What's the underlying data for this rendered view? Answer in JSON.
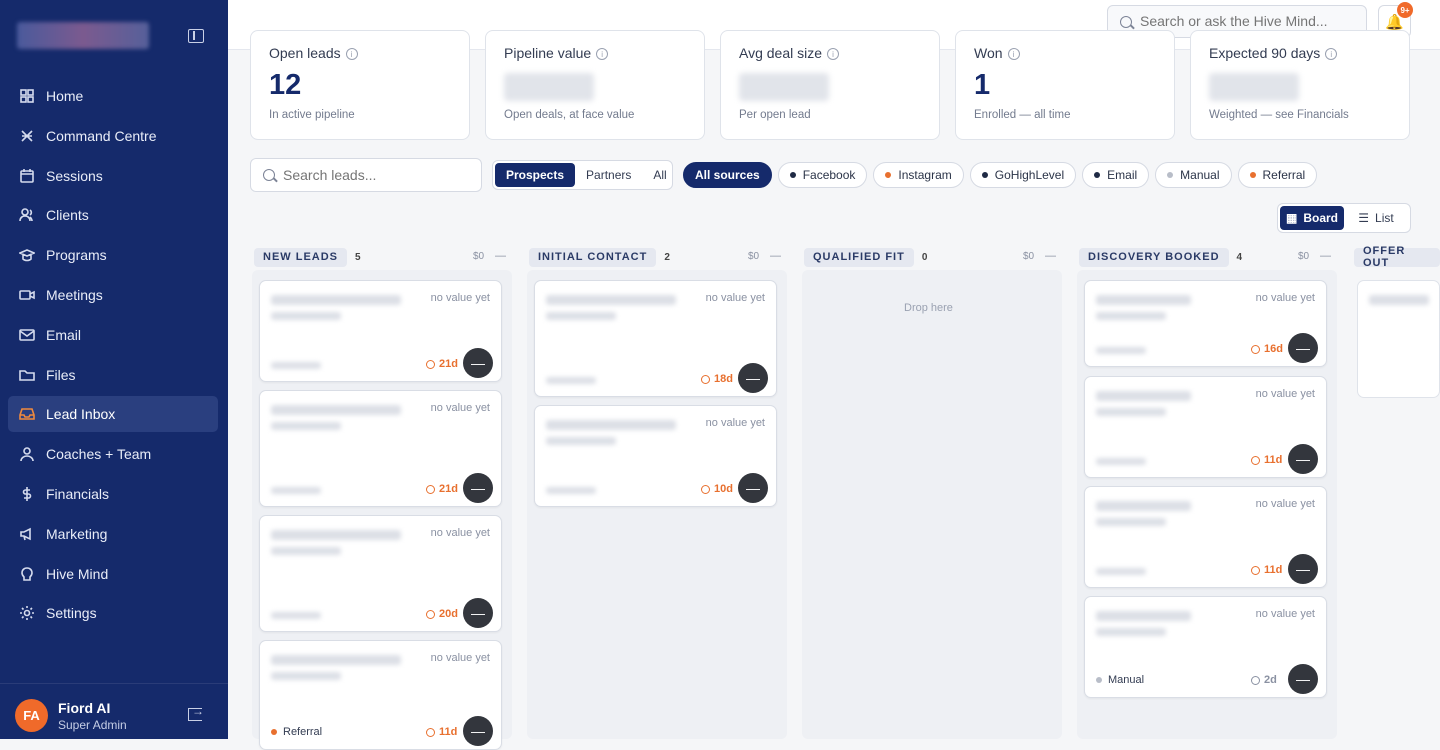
{
  "sidebar": {
    "items": [
      {
        "label": "Home",
        "icon": "home-icon"
      },
      {
        "label": "Command Centre",
        "icon": "command-icon"
      },
      {
        "label": "Sessions",
        "icon": "calendar-icon"
      },
      {
        "label": "Clients",
        "icon": "users-icon"
      },
      {
        "label": "Programs",
        "icon": "graduation-icon"
      },
      {
        "label": "Meetings",
        "icon": "video-icon"
      },
      {
        "label": "Email",
        "icon": "mail-icon"
      },
      {
        "label": "Files",
        "icon": "folder-icon"
      },
      {
        "label": "Lead Inbox",
        "icon": "inbox-icon",
        "active": true
      },
      {
        "label": "Coaches + Team",
        "icon": "team-icon"
      },
      {
        "label": "Financials",
        "icon": "dollar-icon"
      },
      {
        "label": "Marketing",
        "icon": "megaphone-icon"
      },
      {
        "label": "Hive Mind",
        "icon": "brain-icon"
      },
      {
        "label": "Settings",
        "icon": "gear-icon"
      }
    ],
    "user": {
      "initials": "FA",
      "name": "Fiord AI",
      "role": "Super Admin"
    }
  },
  "topbar": {
    "search_placeholder": "Search or ask the Hive Mind...",
    "notif_badge": "9+"
  },
  "kpis": [
    {
      "label": "Open leads",
      "value": "12",
      "sub": "In active pipeline"
    },
    {
      "label": "Pipeline value",
      "value": "",
      "sub": "Open deals, at face value"
    },
    {
      "label": "Avg deal size",
      "value": "",
      "sub": "Per open lead"
    },
    {
      "label": "Won",
      "value": "1",
      "sub": "Enrolled — all time"
    },
    {
      "label": "Expected 90 days",
      "value": "",
      "sub": "Weighted — see Financials"
    }
  ],
  "filters": {
    "search_placeholder": "Search leads...",
    "segments": [
      "Prospects",
      "Partners",
      "All"
    ],
    "sources": [
      {
        "label": "All sources",
        "color": ""
      },
      {
        "label": "Facebook",
        "color": "#1f2a44"
      },
      {
        "label": "Instagram",
        "color": "#e8702f"
      },
      {
        "label": "GoHighLevel",
        "color": "#1f2a44"
      },
      {
        "label": "Email",
        "color": "#1f2a44"
      },
      {
        "label": "Manual",
        "color": "#b8bdc8"
      },
      {
        "label": "Referral",
        "color": "#e8702f"
      }
    ],
    "views": [
      "Board",
      "List"
    ]
  },
  "columns": [
    {
      "title": "NEW LEADS",
      "count": "5",
      "amount": "$0",
      "dash": "—"
    },
    {
      "title": "INITIAL CONTACT",
      "count": "2",
      "amount": "$0",
      "dash": "—"
    },
    {
      "title": "QUALIFIED FIT",
      "count": "0",
      "amount": "$0",
      "dash": "—",
      "drop": "Drop here"
    },
    {
      "title": "DISCOVERY BOOKED",
      "count": "4",
      "amount": "$0",
      "dash": "—"
    },
    {
      "title": "OFFER OUT",
      "count": "",
      "amount": "",
      "dash": ""
    }
  ],
  "cards": {
    "no_value": "no value yet",
    "ages": [
      "21d",
      "21d",
      "20d",
      "11d",
      "18d",
      "10d",
      "16d",
      "11d",
      "11d",
      "2d"
    ],
    "visible_sources": [
      "Manual",
      "Referral"
    ],
    "action": "—"
  }
}
